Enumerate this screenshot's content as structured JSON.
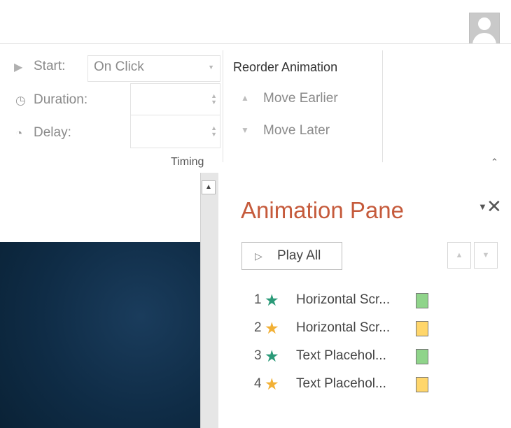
{
  "colors": {
    "entrance_star": "#2a9a78",
    "exit_star": "#f2b035",
    "entrance_bar": "#8fd48a",
    "exit_bar": "#ffd66b",
    "pane_title": "#c55a3b"
  },
  "timing": {
    "start_label": "Start:",
    "start_value": "On Click",
    "duration_label": "Duration:",
    "delay_label": "Delay:",
    "group_label": "Timing"
  },
  "reorder": {
    "title": "Reorder Animation",
    "move_earlier": "Move Earlier",
    "move_later": "Move Later"
  },
  "animation_pane": {
    "title": "Animation Pane",
    "play_all": "Play All",
    "items": [
      {
        "number": "1",
        "name": "Horizontal Scr...",
        "icon": "entrance-star-icon",
        "kind": "entrance"
      },
      {
        "number": "2",
        "name": "Horizontal Scr...",
        "icon": "exit-star-icon",
        "kind": "exit"
      },
      {
        "number": "3",
        "name": "Text Placehol...",
        "icon": "entrance-star-icon",
        "kind": "entrance"
      },
      {
        "number": "4",
        "name": "Text Placehol...",
        "icon": "exit-star-icon",
        "kind": "exit"
      }
    ]
  }
}
